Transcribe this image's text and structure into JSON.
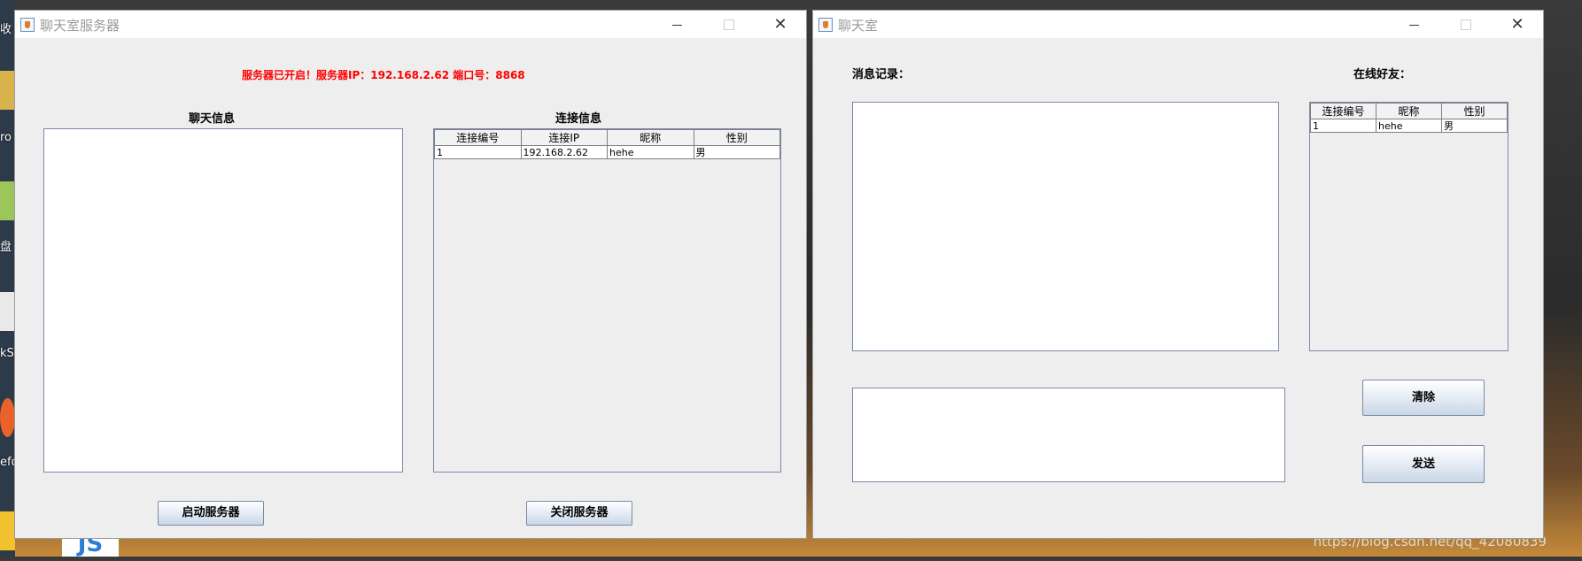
{
  "desktop": {
    "labels": [
      "收",
      "ro",
      "盘",
      "kSp",
      "efo"
    ],
    "taskbar_glyph": "JS",
    "watermark": "https://blog.csdn.net/qq_42080839"
  },
  "server_window": {
    "title": "聊天室服务器",
    "status": "服务器已开启！服务器IP：192.168.2.62 端口号：8868",
    "chat_label": "聊天信息",
    "conn_label": "连接信息",
    "table": {
      "headers": [
        "连接编号",
        "连接IP",
        "昵称",
        "性别"
      ],
      "rows": [
        [
          "1",
          "192.168.2.62",
          "hehe",
          "男"
        ]
      ]
    },
    "start_button": "启动服务器",
    "stop_button": "关闭服务器"
  },
  "client_window": {
    "title": "聊天室",
    "messages_label": "消息记录：",
    "online_label": "在线好友：",
    "table": {
      "headers": [
        "连接编号",
        "昵称",
        "性别"
      ],
      "rows": [
        [
          "1",
          "hehe",
          "男"
        ]
      ]
    },
    "clear_button": "清除",
    "send_button": "发送"
  },
  "colors": {
    "status_red": "#ff0000",
    "window_bg": "#eeeeee"
  }
}
